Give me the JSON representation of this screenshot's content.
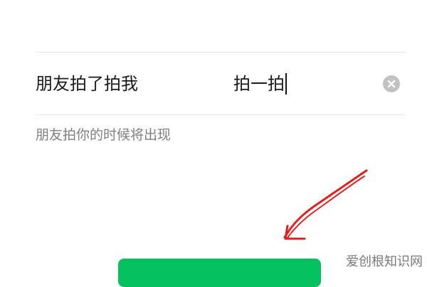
{
  "settings": {
    "row_label": "朋友拍了拍我",
    "input_value": "拍一拍",
    "hint": "朋友拍你的时候将出现"
  },
  "icons": {
    "clear": "close-circle-icon",
    "annotation": "red-arrow"
  },
  "watermark": "爱创根知识网",
  "colors": {
    "accent": "#07c160",
    "clear_icon_bg": "#c2c2c2",
    "annotation": "#e02020",
    "hint_text": "#7f7f7f"
  }
}
